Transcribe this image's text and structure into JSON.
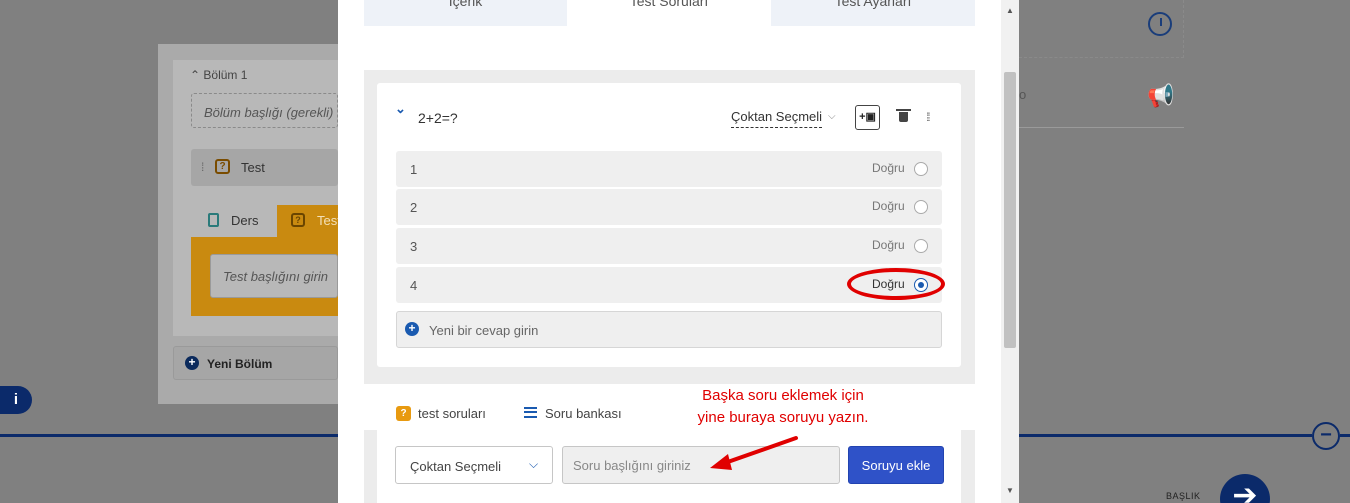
{
  "background": {
    "section_label": "Bölüm 1",
    "section_title_placeholder": "Bölüm başlığı (gerekli)",
    "test_item_label": "Test",
    "tab_ders": "Ders",
    "tab_test": "Test",
    "test_title_placeholder": "Test başlığını girin",
    "new_section_label": "Yeni Bölüm",
    "right_row_text": "o",
    "footer_label": "BAŞLIK"
  },
  "modal": {
    "tabs": [
      {
        "label": "İçerik"
      },
      {
        "label": "Test Soruları"
      },
      {
        "label": "Test Ayarları"
      }
    ],
    "question": {
      "title": "2+2=?",
      "type": "Çoktan Seçmeli",
      "image_button_label": "+",
      "answers": [
        {
          "label": "1",
          "correct_label": "Doğru",
          "selected": false
        },
        {
          "label": "2",
          "correct_label": "Doğru",
          "selected": false
        },
        {
          "label": "3",
          "correct_label": "Doğru",
          "selected": false
        },
        {
          "label": "4",
          "correct_label": "Doğru",
          "selected": true
        }
      ],
      "new_answer_label": "Yeni bir cevap girin"
    },
    "bottom_tabs": {
      "questions_label": "test soruları",
      "bank_label": "Soru bankası"
    },
    "new_question": {
      "type_value": "Çoktan Seçmeli",
      "title_placeholder": "Soru başlığını giriniz",
      "add_button_label": "Soruyu ekle"
    },
    "annotation": {
      "line1": "Başka soru eklemek için",
      "line2": "yine buraya soruyu yazın."
    }
  },
  "colors": {
    "accent_blue": "#2f52c8",
    "annotation_red": "#e00000",
    "test_orange": "#e89a10"
  }
}
